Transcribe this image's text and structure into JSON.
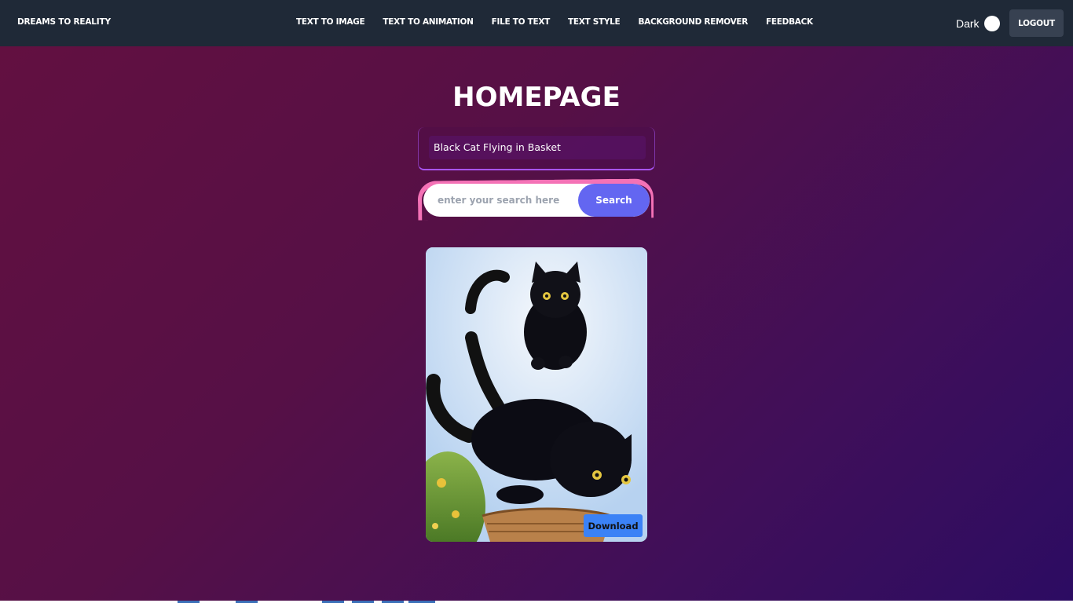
{
  "navbar": {
    "brand": "DREAMS TO REALITY",
    "links": [
      {
        "label": "TEXT TO IMAGE"
      },
      {
        "label": "TEXT TO ANIMATION"
      },
      {
        "label": "FILE TO TEXT"
      },
      {
        "label": "TEXT STYLE"
      },
      {
        "label": "BACKGROUND REMOVER"
      },
      {
        "label": "FEEDBACK"
      }
    ],
    "theme_label": "Dark",
    "logout_label": "LOGOUT"
  },
  "main": {
    "title": "HOMEPAGE",
    "prompt_text": "Black Cat Flying in Basket",
    "search": {
      "placeholder": "enter your search here",
      "value": "",
      "button_label": "Search"
    },
    "result": {
      "icon": "generated-image",
      "download_label": "Download"
    }
  },
  "colors": {
    "navbar": "#1f2937",
    "search_button": "#6366f1",
    "download_button": "#3b82f6",
    "glow": "#f472b6",
    "card_border": "#a855f7"
  }
}
